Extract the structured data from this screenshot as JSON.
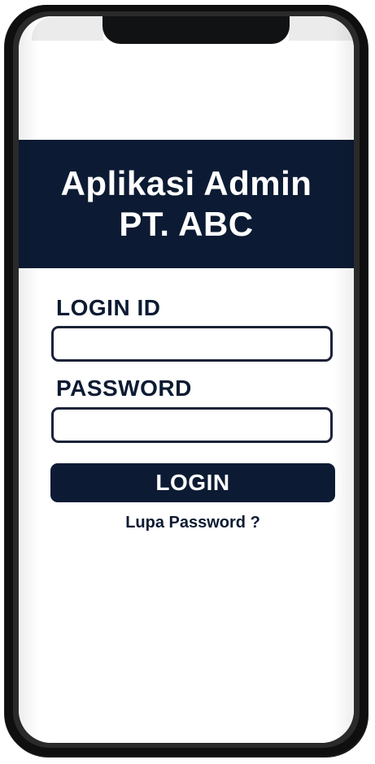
{
  "header": {
    "title_line1": "Aplikasi Admin",
    "title_line2": "PT. ABC"
  },
  "form": {
    "login_id_label": "LOGIN ID",
    "login_id_value": "",
    "password_label": "PASSWORD",
    "password_value": "",
    "login_button_label": "LOGIN",
    "forgot_password_label": "Lupa Password ?"
  },
  "colors": {
    "header_background": "#0c1b33",
    "button_background": "#0c1b33",
    "label_text": "#0c1b33",
    "phone_frame": "#0f0f10"
  }
}
